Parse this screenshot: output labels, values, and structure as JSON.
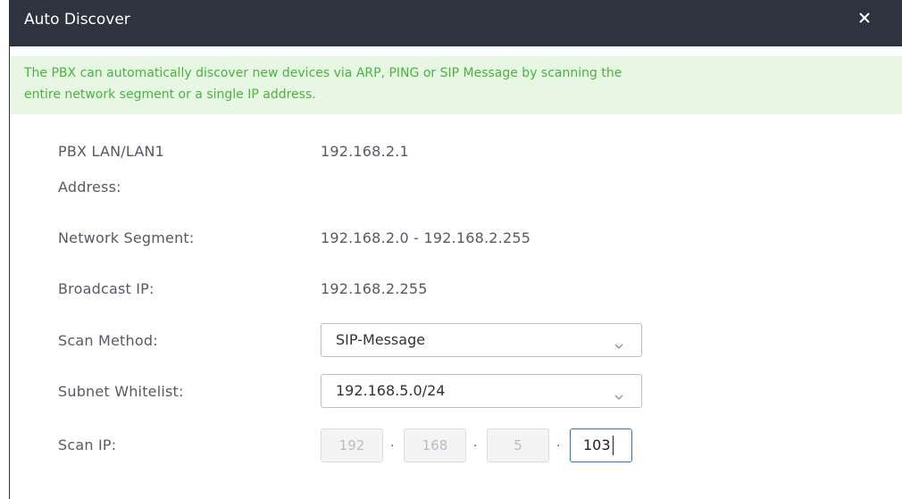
{
  "dialog": {
    "title": "Auto Discover",
    "close_icon": "close-icon",
    "notice_line1": "The PBX can automatically discover new devices via ARP, PING or SIP Message by scanning the",
    "notice_line2": "entire network segment or a single IP address."
  },
  "fields": {
    "pbx_lan_label_line1": "PBX LAN/LAN1",
    "pbx_lan_label_line2": "Address:",
    "pbx_lan_value": "192.168.2.1",
    "network_segment_label": "Network Segment:",
    "network_segment_value": "192.168.2.0 - 192.168.2.255",
    "broadcast_ip_label": "Broadcast IP:",
    "broadcast_ip_value": "192.168.2.255",
    "scan_method_label": "Scan Method:",
    "scan_method_value": "SIP-Message",
    "subnet_whitelist_label": "Subnet Whitelist:",
    "subnet_whitelist_value": "192.168.5.0/24",
    "scan_ip_label": "Scan IP:",
    "scan_ip_octet1": "192",
    "scan_ip_octet2": "168",
    "scan_ip_octet3": "5",
    "scan_ip_octet4": "103",
    "ip_separator": "."
  },
  "colors": {
    "titlebar_bg": "#2f3340",
    "notice_bg": "#e7f7e4",
    "notice_text": "#48b43e",
    "focus_border": "#2f6fd6"
  }
}
